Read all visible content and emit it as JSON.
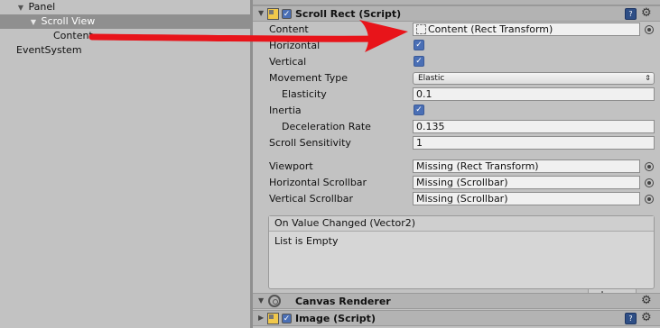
{
  "hierarchy": {
    "items": [
      {
        "label": "Panel",
        "expanded": true
      },
      {
        "label": "Scroll View",
        "expanded": true,
        "selected": true
      },
      {
        "label": "Content"
      },
      {
        "label": "EventSystem"
      }
    ]
  },
  "inspector": {
    "scroll_rect": {
      "title": "Scroll Rect (Script)",
      "enabled": true,
      "props": {
        "content": {
          "label": "Content",
          "value": "Content (Rect Transform)"
        },
        "horizontal": {
          "label": "Horizontal",
          "checked": true
        },
        "vertical": {
          "label": "Vertical",
          "checked": true
        },
        "movement_type": {
          "label": "Movement Type",
          "value": "Elastic"
        },
        "elasticity": {
          "label": "Elasticity",
          "value": "0.1"
        },
        "inertia": {
          "label": "Inertia",
          "checked": true
        },
        "deceleration_rate": {
          "label": "Deceleration Rate",
          "value": "0.135"
        },
        "scroll_sensitivity": {
          "label": "Scroll Sensitivity",
          "value": "1"
        },
        "viewport": {
          "label": "Viewport",
          "value": "Missing (Rect Transform)"
        },
        "horizontal_scrollbar": {
          "label": "Horizontal Scrollbar",
          "value": "Missing (Scrollbar)"
        },
        "vertical_scrollbar": {
          "label": "Vertical Scrollbar",
          "value": "Missing (Scrollbar)"
        }
      },
      "event": {
        "header": "On Value Changed (Vector2)",
        "empty_text": "List is Empty",
        "add_label": "+",
        "remove_label": "−"
      }
    },
    "canvas_renderer": {
      "title": "Canvas Renderer"
    },
    "image": {
      "title": "Image (Script)",
      "enabled": true
    }
  },
  "colors": {
    "annotation": "#e8141a",
    "checkbox": "#4a6fb5",
    "selection": "#8f8f8f"
  },
  "icons": {
    "fold": "triangle-down",
    "script": "script-icon",
    "help": "book-icon",
    "settings": "gear-icon",
    "object_picker": "target-icon"
  }
}
